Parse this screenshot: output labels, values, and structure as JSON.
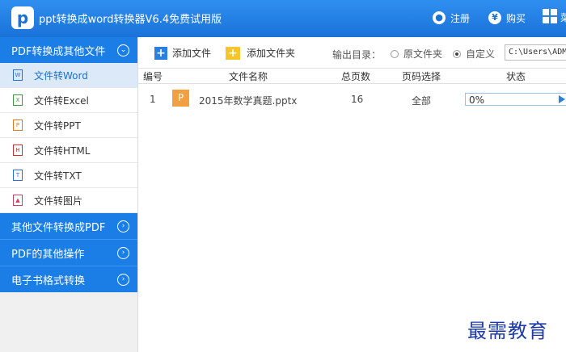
{
  "app": {
    "logo_letter": "p",
    "title": "ppt转换成word转换器V6.4免费试用版"
  },
  "titlebar": {
    "register_label": "注册",
    "register_icon": "user-icon",
    "buy_label": "购买",
    "buy_icon": "yen-icon",
    "menu_icon": "grid-icon",
    "cut_text": "菜"
  },
  "sidebar": {
    "categories": [
      {
        "label": "PDF转换成其他文件",
        "icon": "chevron-down-icon",
        "expanded": true
      },
      {
        "label": "其他文件转换成PDF",
        "icon": "chevron-right-icon"
      },
      {
        "label": "PDF的其他操作",
        "icon": "chevron-right-icon"
      },
      {
        "label": "电子书格式转换",
        "icon": "chevron-right-icon"
      }
    ],
    "items": [
      {
        "label": "文件转Word",
        "glyph": "W",
        "color": "#2a6fd6",
        "active": true
      },
      {
        "label": "文件转Excel",
        "glyph": "X",
        "color": "#3a9c3a"
      },
      {
        "label": "文件转PPT",
        "glyph": "P",
        "color": "#e07a20"
      },
      {
        "label": "文件转HTML",
        "glyph": "H",
        "color": "#d03030"
      },
      {
        "label": "文件转TXT",
        "glyph": "T",
        "color": "#2a6fd6"
      },
      {
        "label": "文件转图片",
        "glyph": "▲",
        "color": "#d04060"
      }
    ]
  },
  "toolbar": {
    "add_file": "添加文件",
    "add_folder": "添加文件夹",
    "output_label": "输出目录：",
    "option_original": "原文件夹",
    "option_custom": "自定义",
    "selected_option": "custom",
    "path_value": "C:\\Users\\ADMINI"
  },
  "table": {
    "headers": [
      "编号",
      "文件名称",
      "总页数",
      "页码选择",
      "状态"
    ],
    "rows": [
      {
        "index": "1",
        "icon_letter": "P",
        "filename": "2015年数学真题.pptx",
        "pages": "16",
        "page_select": "全部",
        "progress": "0%"
      }
    ]
  },
  "watermark": "最需教育"
}
